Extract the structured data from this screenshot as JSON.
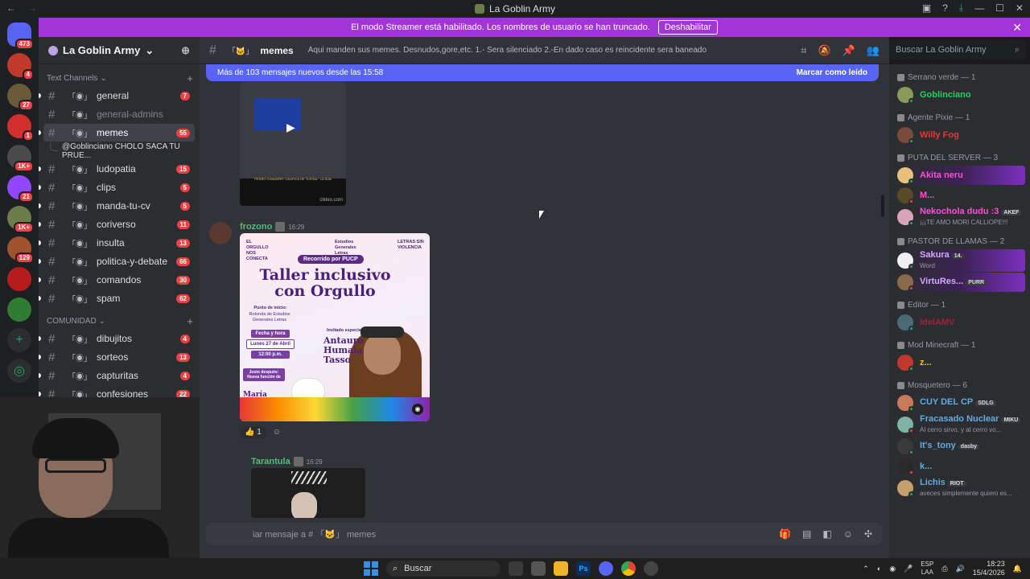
{
  "window": {
    "title": "La Goblin Army",
    "nav_back": "←",
    "nav_forward": "→"
  },
  "streamer_banner": {
    "text": "El modo Streamer está habilitado. Los nombres de usuario se han truncado.",
    "button": "Deshabilitar",
    "close": "✕"
  },
  "guilds": [
    {
      "name": "direct-messages",
      "badge": "473",
      "color": "#5865f2"
    },
    {
      "name": "server-1",
      "badge": "4",
      "color": "#c0392b"
    },
    {
      "name": "server-2",
      "badge": "27",
      "color": "#6b5a3a"
    },
    {
      "name": "server-3",
      "badge": "1",
      "color": "#d32f2f"
    },
    {
      "name": "server-4",
      "badge": "1K+",
      "color": "#4b4b4b"
    },
    {
      "name": "server-5",
      "badge": "21",
      "color": "#9147ff"
    },
    {
      "name": "server-6",
      "badge": "1K+",
      "color": "#6b7d4a"
    },
    {
      "name": "server-7",
      "badge": "129",
      "color": "#a0522d"
    },
    {
      "name": "server-8",
      "badge": "",
      "color": "#b71c1c"
    },
    {
      "name": "server-9",
      "badge": "",
      "color": "#2e7d32"
    }
  ],
  "server": {
    "name": "La Goblin Army",
    "chevron": "⌄"
  },
  "categories": [
    {
      "label": "Text Channels",
      "channels": [
        {
          "name": "general",
          "count": "7",
          "state": "unread"
        },
        {
          "name": "general-admins",
          "count": "",
          "state": "muted"
        },
        {
          "name": "memes",
          "count": "55",
          "state": "active"
        },
        {
          "name": "ludopatia",
          "count": "15",
          "state": "unread"
        },
        {
          "name": "clips",
          "count": "5",
          "state": "unread"
        },
        {
          "name": "manda-tu-cv",
          "count": "5",
          "state": "unread"
        },
        {
          "name": "coriverso",
          "count": "11",
          "state": "unread"
        },
        {
          "name": "insulta",
          "count": "13",
          "state": "unread"
        },
        {
          "name": "politica-y-debate",
          "count": "66",
          "state": "unread"
        },
        {
          "name": "comandos",
          "count": "30",
          "state": "unread"
        },
        {
          "name": "spam",
          "count": "62",
          "state": "unread"
        }
      ]
    },
    {
      "label": "COMUNIDAD",
      "channels": [
        {
          "name": "dibujitos",
          "count": "4",
          "state": "unread"
        },
        {
          "name": "sorteos",
          "count": "13",
          "state": "unread"
        },
        {
          "name": "capturitas",
          "count": "4",
          "state": "unread"
        },
        {
          "name": "confesiones",
          "count": "22",
          "state": "unread"
        }
      ]
    }
  ],
  "thread": {
    "label": "@Goblinciano CHOLO SACA TU PRUE..."
  },
  "channel_header": {
    "name": "memes",
    "topic": "Aqui manden sus memes. Desnudos,gore,etc. 1.- Sera silenciado 2.-En dado caso es reincidente sera baneado",
    "search_placeholder": "Buscar La Goblin Army"
  },
  "new_messages_bar": {
    "text": "Más de 103 mensajes nuevos desde las 15:58",
    "action": "Marcar como leído"
  },
  "messages": [
    {
      "video_caption": "PEDRO CHAVARRY CALIFICA DE \"ILEGAL\" LA SUB",
      "video_source": "clideo.com"
    },
    {
      "author": "frozono",
      "time": "16:29",
      "poster": {
        "tag": "Recorrido por PUCP",
        "title": "Taller inclusivo con Orgullo",
        "org_left": "EL ORGULLO NOS CONECTA",
        "org_mid": "Estudios Generales Letras",
        "org_right": "LETRAS SIN VIOLENCIA",
        "start_label": "Punto de inicio:",
        "start_value": "Rotonda de Estudios Generales Letras",
        "date_label": "Fecha y hora",
        "date_value": "Lunes 27 de Abril",
        "time_value": "12:00 p.m.",
        "guest_label": "Invitado especial",
        "guest_name": "Antauro Humala Tasso",
        "after_label": "Justo después: Nueva función de",
        "after_value": "María Maricón"
      },
      "reaction_count": "1"
    },
    {
      "author": "Tarantula",
      "time": "16:29"
    }
  ],
  "composer": {
    "placeholder": "iar mensaje a # 「🐱」 memes"
  },
  "member_groups": [
    {
      "role": "Serrano verde — 1",
      "members": [
        {
          "name": "Goblinciano",
          "color": "#23d160",
          "sub": "",
          "badge": "",
          "boosted": false,
          "avatar": "#8a9a5b"
        }
      ]
    },
    {
      "role": "Agente Pixie — 1",
      "members": [
        {
          "name": "Willy Fog",
          "color": "#e53935",
          "sub": "",
          "badge": "",
          "boosted": false,
          "avatar": "#7a4a3a"
        }
      ]
    },
    {
      "role": "PUTA DEL SERVER — 3",
      "members": [
        {
          "name": "Akita neru",
          "color": "#ff4fd8",
          "sub": "",
          "badge": "",
          "boosted": true,
          "avatar": "#e6c27a"
        },
        {
          "name": "M...",
          "color": "#ff4fd8",
          "sub": "",
          "badge": "",
          "boosted": false,
          "avatar": "#5a4a2a"
        },
        {
          "name": "Nekochola dudu :3",
          "color": "#ff4fd8",
          "sub": "¡¡¡TE AMO MORI CALLIOPE!!!",
          "badge": "AKEF",
          "boosted": false,
          "avatar": "#d9a3b8"
        }
      ]
    },
    {
      "role": "PASTOR DE LLAMAS — 2",
      "members": [
        {
          "name": "Sakura",
          "color": "#d5a8ff",
          "sub": "Word",
          "badge": "14.",
          "boosted": true,
          "avatar": "#f0f0f0"
        },
        {
          "name": "VirtuRes...",
          "color": "#d5a8ff",
          "sub": "",
          "badge": "PURR",
          "boosted": true,
          "avatar": "#8a6a4a"
        }
      ]
    },
    {
      "role": "Editor — 1",
      "members": [
        {
          "name": "IdelAMV",
          "color": "#a0233a",
          "sub": "",
          "badge": "",
          "boosted": false,
          "avatar": "#4a6a7a"
        }
      ]
    },
    {
      "role": "Mod Minecraft — 1",
      "members": [
        {
          "name": "z...",
          "color": "#f1c40f",
          "sub": "",
          "badge": "",
          "boosted": false,
          "avatar": "#c0392b"
        }
      ]
    },
    {
      "role": "Mosquetero — 6",
      "members": [
        {
          "name": "CUY DEL CP",
          "color": "#5dade2",
          "sub": "",
          "badge": "SDLG",
          "boosted": false,
          "avatar": "#c97a5a"
        },
        {
          "name": "Fracasado Nuclear",
          "color": "#5dade2",
          "sub": "Al cerro sirvo, y al cerro vo...",
          "badge": "MIKU",
          "boosted": false,
          "avatar": "#7fb3a6"
        },
        {
          "name": "It's_tony",
          "color": "#5dade2",
          "sub": "",
          "badge": "dasby",
          "boosted": false,
          "avatar": "#3a3a3a"
        },
        {
          "name": "k...",
          "color": "#5dade2",
          "sub": "",
          "badge": "",
          "boosted": false,
          "avatar": "#2a2a2a"
        },
        {
          "name": "Lichis",
          "color": "#5dade2",
          "sub": "aveces simplemente quiero es...",
          "badge": "RIOT",
          "boosted": false,
          "avatar": "#c4a070"
        }
      ]
    }
  ],
  "taskbar": {
    "search": "Buscar",
    "lang_top": "ESP",
    "lang_bottom": "LAA",
    "time": "18:23",
    "date": "15/4/2026"
  }
}
